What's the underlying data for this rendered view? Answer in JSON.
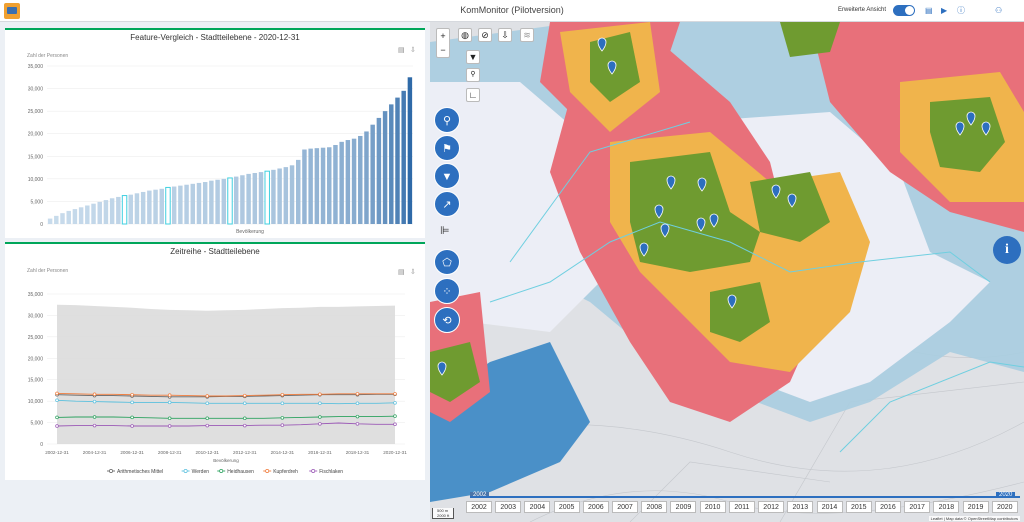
{
  "app": {
    "title": "KomMonitor (Pilotversion)",
    "toggle_label": "Erweiterte Ansicht",
    "toggle_on": true,
    "icons": [
      "document-icon",
      "play-icon",
      "info-icon",
      "users-icon"
    ]
  },
  "colors": {
    "accent": "#2d6fbf",
    "panel_border": "#00a65a",
    "bar_light": "#c9dcec",
    "bar_dark": "#2f6aa8",
    "bar_highlight": "#40d0e0",
    "red_zone": "#e8707a",
    "orange_zone": "#f0b44c",
    "green_zone": "#6f9b30",
    "light_blue": "#a9cde0",
    "dark_blue": "#4a90c8"
  },
  "chart1": {
    "title": "Feature-Vergleich - Stadtteilebene - 2020-12-31",
    "ylabel": "Zahl der Personen",
    "xlabel": "Bevölkerung"
  },
  "chart2": {
    "title": "Zeitreihe - Stadtteilebene",
    "ylabel": "Zahl der Personen",
    "xlabel": "Bevölkerung"
  },
  "chart_data": [
    {
      "type": "bar",
      "title": "Feature-Vergleich - Stadtteilebene - 2020-12-31",
      "ylabel": "Zahl der Personen",
      "xlabel": "Bevölkerung",
      "ylim": [
        0,
        35000
      ],
      "yticks": [
        0,
        5000,
        10000,
        15000,
        20000,
        25000,
        30000,
        35000
      ],
      "ytick_labels": [
        "0",
        "5,000",
        "10,000",
        "15,000",
        "20,000",
        "25,000",
        "30,000",
        "35,000"
      ],
      "values": [
        1200,
        1800,
        2400,
        2900,
        3300,
        3700,
        4100,
        4500,
        4900,
        5300,
        5700,
        6000,
        6300,
        6500,
        6800,
        7100,
        7400,
        7600,
        7800,
        8100,
        8300,
        8500,
        8700,
        8900,
        9100,
        9300,
        9600,
        9800,
        10000,
        10200,
        10500,
        10800,
        11100,
        11300,
        11500,
        11700,
        12000,
        12300,
        12600,
        13000,
        14200,
        16500,
        16700,
        16800,
        16900,
        17000,
        17500,
        18200,
        18600,
        18900,
        19500,
        20500,
        22000,
        23500,
        25000,
        26500,
        28000,
        29500,
        32500
      ],
      "highlighted_indices": [
        12,
        19,
        29,
        35
      ],
      "grid": true
    },
    {
      "type": "line",
      "title": "Zeitreihe - Stadtteilebene",
      "ylabel": "Zahl der Personen",
      "xlabel": "Bevölkerung",
      "ylim": [
        0,
        35000
      ],
      "yticks": [
        0,
        5000,
        10000,
        15000,
        20000,
        25000,
        30000,
        35000
      ],
      "ytick_labels": [
        "0",
        "5,000",
        "10,000",
        "15,000",
        "20,000",
        "25,000",
        "30,000",
        "35,000"
      ],
      "x_labels": [
        "2002-12-31",
        "2004-12-31",
        "2006-12-31",
        "2008-12-31",
        "2010-12-31",
        "2012-12-31",
        "2014-12-31",
        "2016-12-31",
        "2018-12-31",
        "2020-12-31"
      ],
      "range_band": {
        "low": 0,
        "high": [
          32500,
          32400,
          32200,
          32000,
          31800,
          31500,
          31300,
          31200,
          31100,
          31200,
          31300,
          31500,
          31700,
          31800,
          32000,
          32000,
          32100,
          32200,
          32300
        ]
      },
      "series": [
        {
          "name": "Arithmetisches Mittel",
          "color": "#666666",
          "values": [
            11500,
            11400,
            11300,
            11300,
            11200,
            11100,
            11000,
            11000,
            11000,
            11100,
            11100,
            11200,
            11300,
            11400,
            11500,
            11500,
            11500,
            11600,
            11600
          ]
        },
        {
          "name": "Werden",
          "color": "#5bc0de",
          "values": [
            10200,
            10000,
            9900,
            9800,
            9700,
            9700,
            9700,
            9600,
            9500,
            9500,
            9500,
            9500,
            9500,
            9500,
            9500,
            9400,
            9500,
            9500,
            9600
          ]
        },
        {
          "name": "Heidhausen",
          "color": "#2ca25f",
          "values": [
            6200,
            6300,
            6300,
            6300,
            6200,
            6100,
            6000,
            6000,
            6000,
            6000,
            6000,
            6000,
            6100,
            6200,
            6300,
            6400,
            6400,
            6400,
            6500
          ]
        },
        {
          "name": "Kupferdreh",
          "color": "#f07c3c",
          "values": [
            11800,
            11700,
            11600,
            11600,
            11500,
            11400,
            11400,
            11300,
            11200,
            11200,
            11300,
            11400,
            11500,
            11600,
            11600,
            11700,
            11700,
            11700,
            11700
          ]
        },
        {
          "name": "Fischlaken",
          "color": "#9b59b6",
          "values": [
            4200,
            4300,
            4300,
            4300,
            4200,
            4200,
            4200,
            4200,
            4300,
            4300,
            4300,
            4400,
            4400,
            4500,
            4700,
            4900,
            4700,
            4600,
            4600
          ]
        }
      ],
      "grid": true,
      "legend": "bottom"
    }
  ],
  "map": {
    "zoom_in": "+",
    "zoom_out": "−",
    "timeline_years": [
      "2002",
      "2003",
      "2004",
      "2005",
      "2006",
      "2007",
      "2008",
      "2009",
      "2010",
      "2011",
      "2012",
      "2013",
      "2014",
      "2015",
      "2016",
      "2017",
      "2018",
      "2019",
      "2020"
    ],
    "timeline_start": "2002",
    "timeline_end": "2020",
    "attribution": "Leaflet | Map data © OpenStreetMap contributors",
    "scale_top": "500 m",
    "scale_bottom": "2000 ft",
    "info_symbol": "i"
  }
}
